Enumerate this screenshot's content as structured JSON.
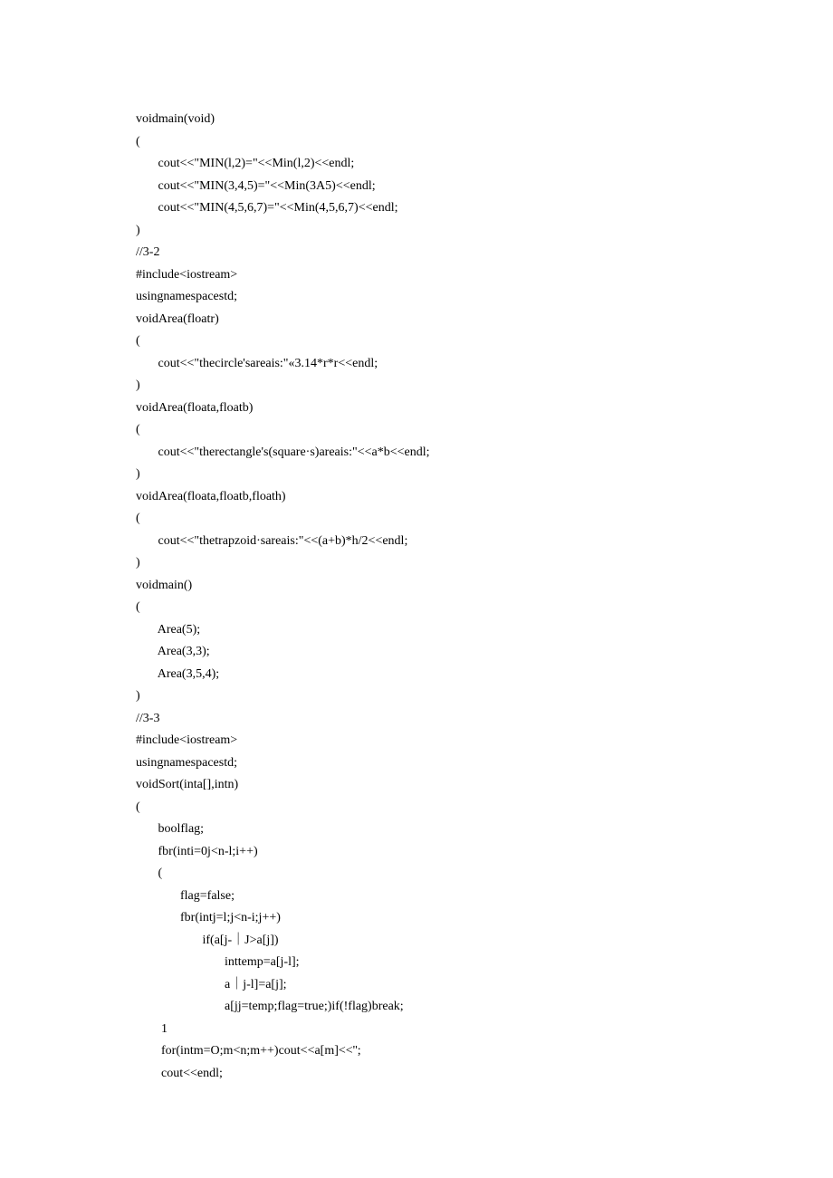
{
  "lines": [
    "voidmain(void)",
    "(",
    "       cout<<\"MIN(l,2)=\"<<Min(l,2)<<endl;",
    "       cout<<\"MIN(3,4,5)=\"<<Min(3A5)<<endl;",
    "       cout<<\"MIN(4,5,6,7)=\"<<Min(4,5,6,7)<<endl;",
    ")",
    "//3-2",
    "#include<iostream>",
    "usingnamespacestd;",
    "voidArea(floatr)",
    "(",
    "       cout<<\"thecircle'sareais:\"«3.14*r*r<<endl;",
    ")",
    "voidArea(floata,floatb)",
    "(",
    "       cout<<\"therectangle's(square·s)areais:\"<<a*b<<endl;",
    ")",
    "voidArea(floata,floatb,floath)",
    "(",
    "       cout<<\"thetrapzoid·sareais:\"<<(a+b)*h/2<<endl;",
    ")",
    "voidmain()",
    "(",
    "       Area(5);",
    "       Area(3,3);",
    "       Area(3,5,4);",
    ")",
    "//3-3",
    "#include<iostream>",
    "usingnamespacestd;",
    "voidSort(inta[],intn)",
    "(",
    "       boolflag;",
    "       fbr(inti=0j<n-l;i++)",
    "       (",
    "              flag=false;",
    "              fbr(intj=l;j<n-i;j++)",
    "                     if(a[j-｜J>a[j])",
    "                            inttemp=a[j-l];",
    "                            a｜j-l]=a[j];",
    "                            a[jj=temp;flag=true;)if(!flag)break;",
    "        1",
    "        for(intm=O;m<n;m++)cout<<a[m]<<'';",
    "        cout<<endl;"
  ]
}
